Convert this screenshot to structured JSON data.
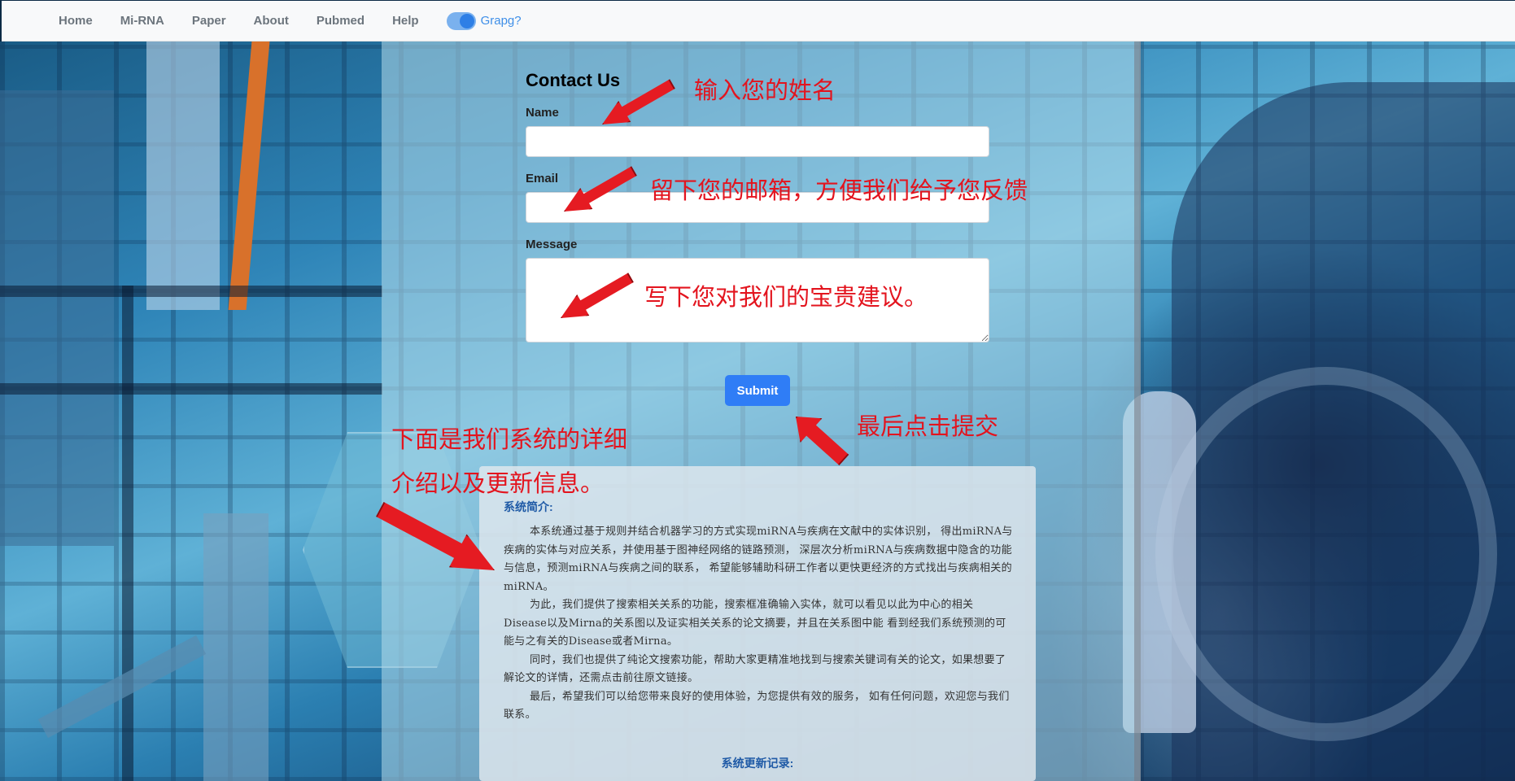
{
  "navbar": {
    "links": [
      "Home",
      "Mi-RNA",
      "Paper",
      "About",
      "Pubmed",
      "Help"
    ],
    "toggle_label": "Grapg?"
  },
  "form": {
    "title": "Contact Us",
    "name_label": "Name",
    "email_label": "Email",
    "message_label": "Message",
    "name_value": "",
    "email_value": "",
    "message_value": "",
    "submit_label": "Submit"
  },
  "annotations": {
    "name_hint": "输入您的姓名",
    "email_hint": "留下您的邮箱，方便我们给予您反馈",
    "message_hint": "写下您对我们的宝贵建议。",
    "submit_hint": "最后点击提交",
    "intro_hint_line1": "下面是我们系统的详细",
    "intro_hint_line2": "介绍以及更新信息。"
  },
  "info": {
    "title": "系统简介:",
    "paragraphs": [
      "本系统通过基于规则并结合机器学习的方式实现miRNA与疾病在文献中的实体识别， 得出miRNA与疾病的实体与对应关系，并使用基于图神经网络的链路预测， 深层次分析miRNA与疾病数据中隐含的功能与信息，预测miRNA与疾病之间的联系， 希望能够辅助科研工作者以更快更经济的方式找出与疾病相关的miRNA。",
      "为此，我们提供了搜索相关关系的功能，搜索框准确输入实体，就可以看见以此为中心的相关Disease以及Mirna的关系图以及证实相关关系的论文摘要，并且在关系图中能 看到经我们系统预测的可能与之有关的Disease或者Mirna。",
      "同时，我们也提供了纯论文搜索功能，帮助大家更精准地找到与搜索关键词有关的论文，如果想要了解论文的详情，还需点击前往原文链接。",
      "最后，希望我们可以给您带来良好的使用体验，为您提供有效的服务， 如有任何问题，欢迎您与我们联系。"
    ],
    "update_title": "系统更新记录:"
  },
  "colors": {
    "annotation_red": "#e3141e",
    "submit_blue": "#2f7df6",
    "info_title_blue": "#1f5aa6"
  }
}
